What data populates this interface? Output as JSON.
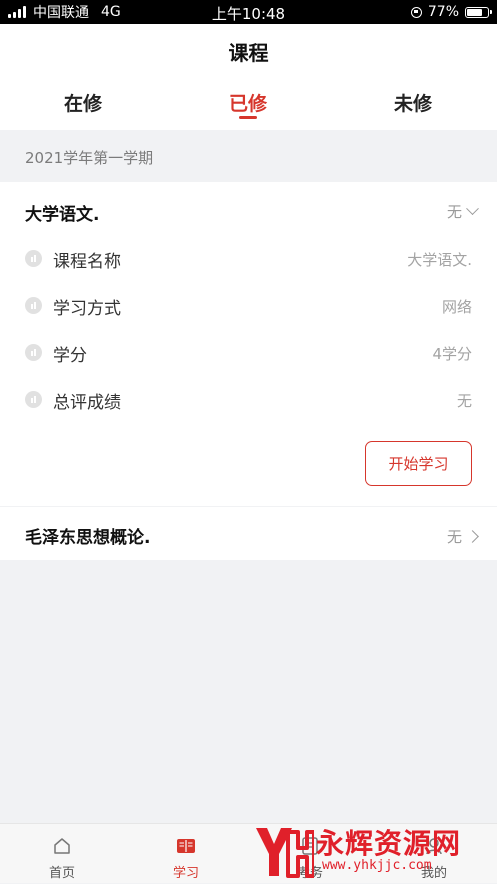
{
  "status_bar": {
    "carrier": "中国联通",
    "network": "4G",
    "time": "上午10:48",
    "battery": "77%",
    "battery_level": 0.77
  },
  "header": {
    "title": "课程",
    "tabs": [
      {
        "label": "在修",
        "active": false
      },
      {
        "label": "已修",
        "active": true
      },
      {
        "label": "未修",
        "active": false
      }
    ]
  },
  "semester": "2021学年第一学期",
  "courses": [
    {
      "title": "大学语文.",
      "status": "无",
      "expanded": true,
      "details": [
        {
          "label": "课程名称",
          "value": "大学语文."
        },
        {
          "label": "学习方式",
          "value": "网络"
        },
        {
          "label": "学分",
          "value": "4学分"
        },
        {
          "label": "总评成绩",
          "value": "无"
        }
      ],
      "action_label": "开始学习"
    },
    {
      "title": "毛泽东思想概论.",
      "status": "无",
      "expanded": false
    }
  ],
  "tabbar": [
    {
      "label": "首页",
      "icon": "home-icon",
      "active": false
    },
    {
      "label": "学习",
      "icon": "book-icon",
      "active": true
    },
    {
      "label": "考务",
      "icon": "exam-icon",
      "active": false
    },
    {
      "label": "我的",
      "icon": "user-icon",
      "active": false
    }
  ],
  "watermark": {
    "brand": "永辉资源网",
    "url": "www.yhkjjc.com"
  },
  "colors": {
    "accent": "#d6362c",
    "background": "#f1f2f4",
    "watermark": "#e0202a"
  }
}
